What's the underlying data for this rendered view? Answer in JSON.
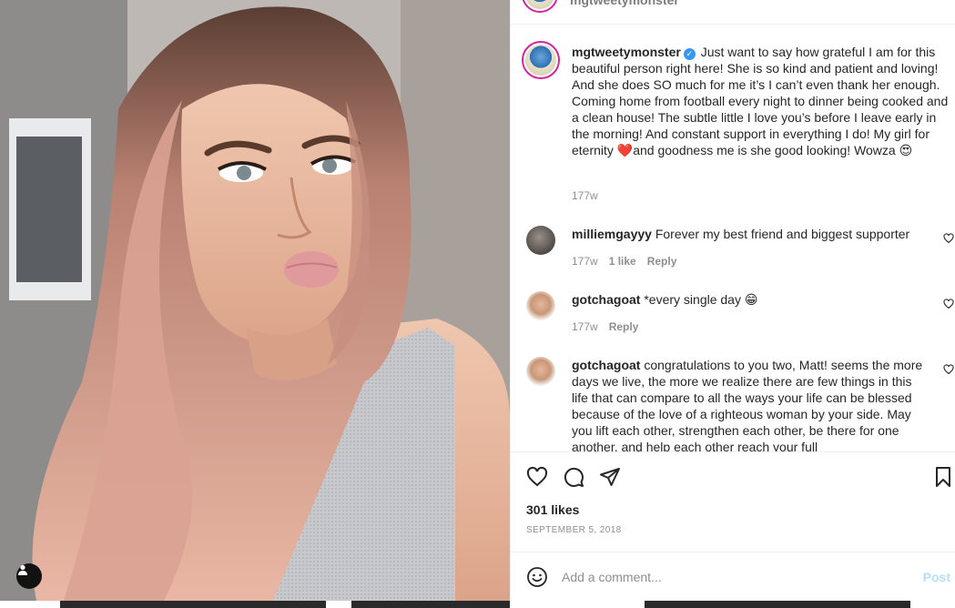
{
  "post": {
    "author": "mgtweetymonster",
    "caption": "Just want to say how grateful I am for this beautiful person right here! She is so kind and patient and loving! And she does SO much for me it’s I can’t even thank her enough. Coming home from football every night to dinner being cooked and a clean house! The subtle little I love you’s before I leave early in the morning! And constant support in everything I do! My girl for eternity ❤️and goodness me is she good looking! Wowza 😍",
    "caption_age": "177w",
    "likes": "301 likes",
    "date": "SEPTEMBER 5, 2018"
  },
  "comments": [
    {
      "user": "milliemgayyy",
      "text": "Forever my best friend and biggest supporter",
      "age": "177w",
      "likes": "1 like",
      "reply": "Reply"
    },
    {
      "user": "gotchagoat",
      "text": "*every single day 😁",
      "age": "177w",
      "reply": "Reply"
    },
    {
      "user": "gotchagoat",
      "text": "congratulations to you two, Matt! seems the more days we live, the more we realize there are few things in this life that can compare to all the ways your life can be blessed because of the love of a righteous woman by your side. May you lift each other, strengthen each other, be there for one another, and help each other reach your full"
    }
  ],
  "comment_box": {
    "placeholder": "Add a comment...",
    "post_label": "Post"
  },
  "icons": {
    "like": "heart-icon",
    "comment": "comment-bubble-icon",
    "share": "paper-plane-icon",
    "save": "bookmark-icon",
    "emoji": "smiley-icon",
    "tags": "user-tag-icon"
  },
  "colors": {
    "verified": "#3897f0",
    "post_disabled": "#b2dffc",
    "muted_text": "#8e8e8e"
  }
}
